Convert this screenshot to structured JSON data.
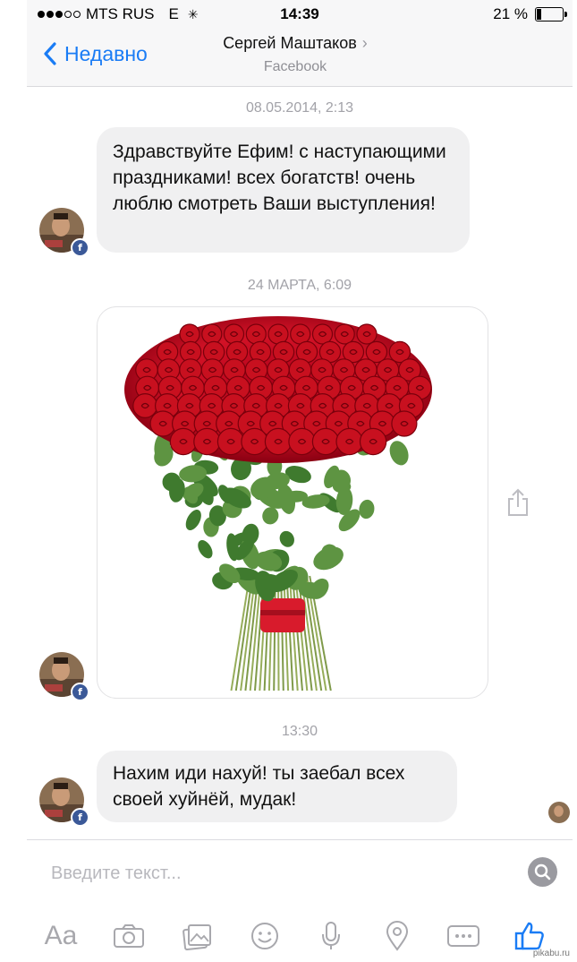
{
  "status_bar": {
    "carrier": "MTS RUS",
    "network": "E",
    "time": "14:39",
    "battery_text": "21 %",
    "battery_level": 0.21,
    "signal_bars_filled": 3,
    "signal_bars_total": 5
  },
  "header": {
    "back_label": "Недавно",
    "contact_name": "Сергей Маштаков",
    "contact_subtitle": "Facebook",
    "accent_color": "#1a7cf5"
  },
  "messages": [
    {
      "timestamp": "08.05.2014, 2:13",
      "text": "Здравствуйте Ефим! с наступающими праздниками! всех богатств! очень люблю смотреть Ваши выступления!"
    },
    {
      "timestamp": "24 МАРТА, 6:09",
      "image": "red-roses-bouquet"
    },
    {
      "timestamp": "13:30",
      "text": "Нахим иди нахуй! ты заебал всех своей хуйнёй, мудак!"
    }
  ],
  "composer": {
    "placeholder": "Введите текст...",
    "text_tool_label": "Aa"
  },
  "toolbar_icons": [
    "text-format-icon",
    "camera-icon",
    "gallery-icon",
    "emoji-icon",
    "microphone-icon",
    "location-icon",
    "more-icon",
    "like-icon"
  ],
  "watermark": "pikabu.ru"
}
